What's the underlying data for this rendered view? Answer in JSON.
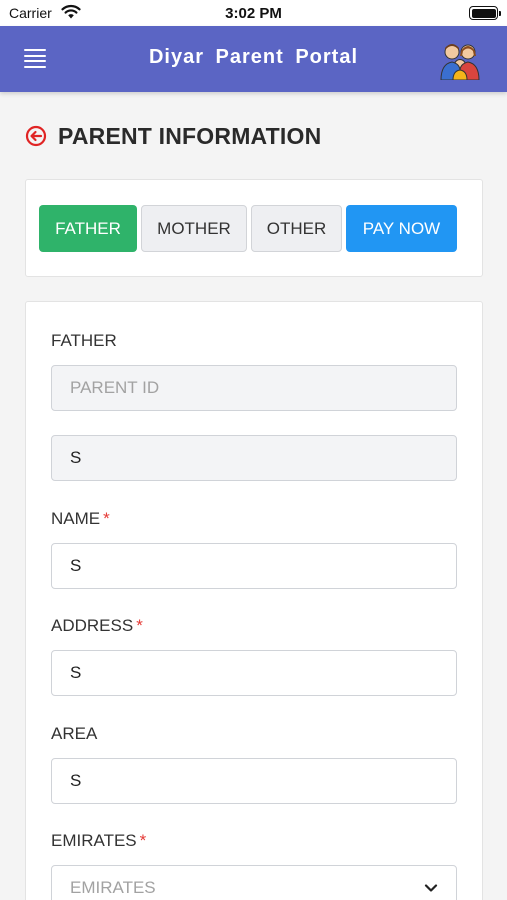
{
  "status_bar": {
    "carrier": "Carrier",
    "time": "3:02 PM"
  },
  "nav": {
    "title": "Diyar Parent Portal",
    "menu_icon": "hamburger-menu-icon",
    "avatar_icon": "family-avatar-icon"
  },
  "page": {
    "title": "PARENT INFORMATION",
    "back_icon": "back-arrow-circle-icon"
  },
  "tabs": [
    {
      "label": "FATHER",
      "active": true
    },
    {
      "label": "MOTHER",
      "active": false
    },
    {
      "label": "OTHER",
      "active": false
    },
    {
      "label": "PAY NOW",
      "active": false
    }
  ],
  "form": {
    "section_title": "FATHER",
    "parent_id": {
      "placeholder": "PARENT ID",
      "value": ""
    },
    "unlabeled_field": {
      "value": "S"
    },
    "name": {
      "label": "NAME",
      "required_mark": "*",
      "value": "S"
    },
    "address": {
      "label": "ADDRESS",
      "required_mark": "*",
      "value": "S"
    },
    "area": {
      "label": "AREA",
      "value": "S"
    },
    "emirates": {
      "label": "EMIRATES",
      "required_mark": "*",
      "placeholder": "EMIRATES"
    }
  },
  "colors": {
    "nav_background": "#5b65c4",
    "active_tab": "#2fb36a",
    "pay_now": "#2196f3",
    "required": "#e53935",
    "back_icon": "#e02424"
  }
}
